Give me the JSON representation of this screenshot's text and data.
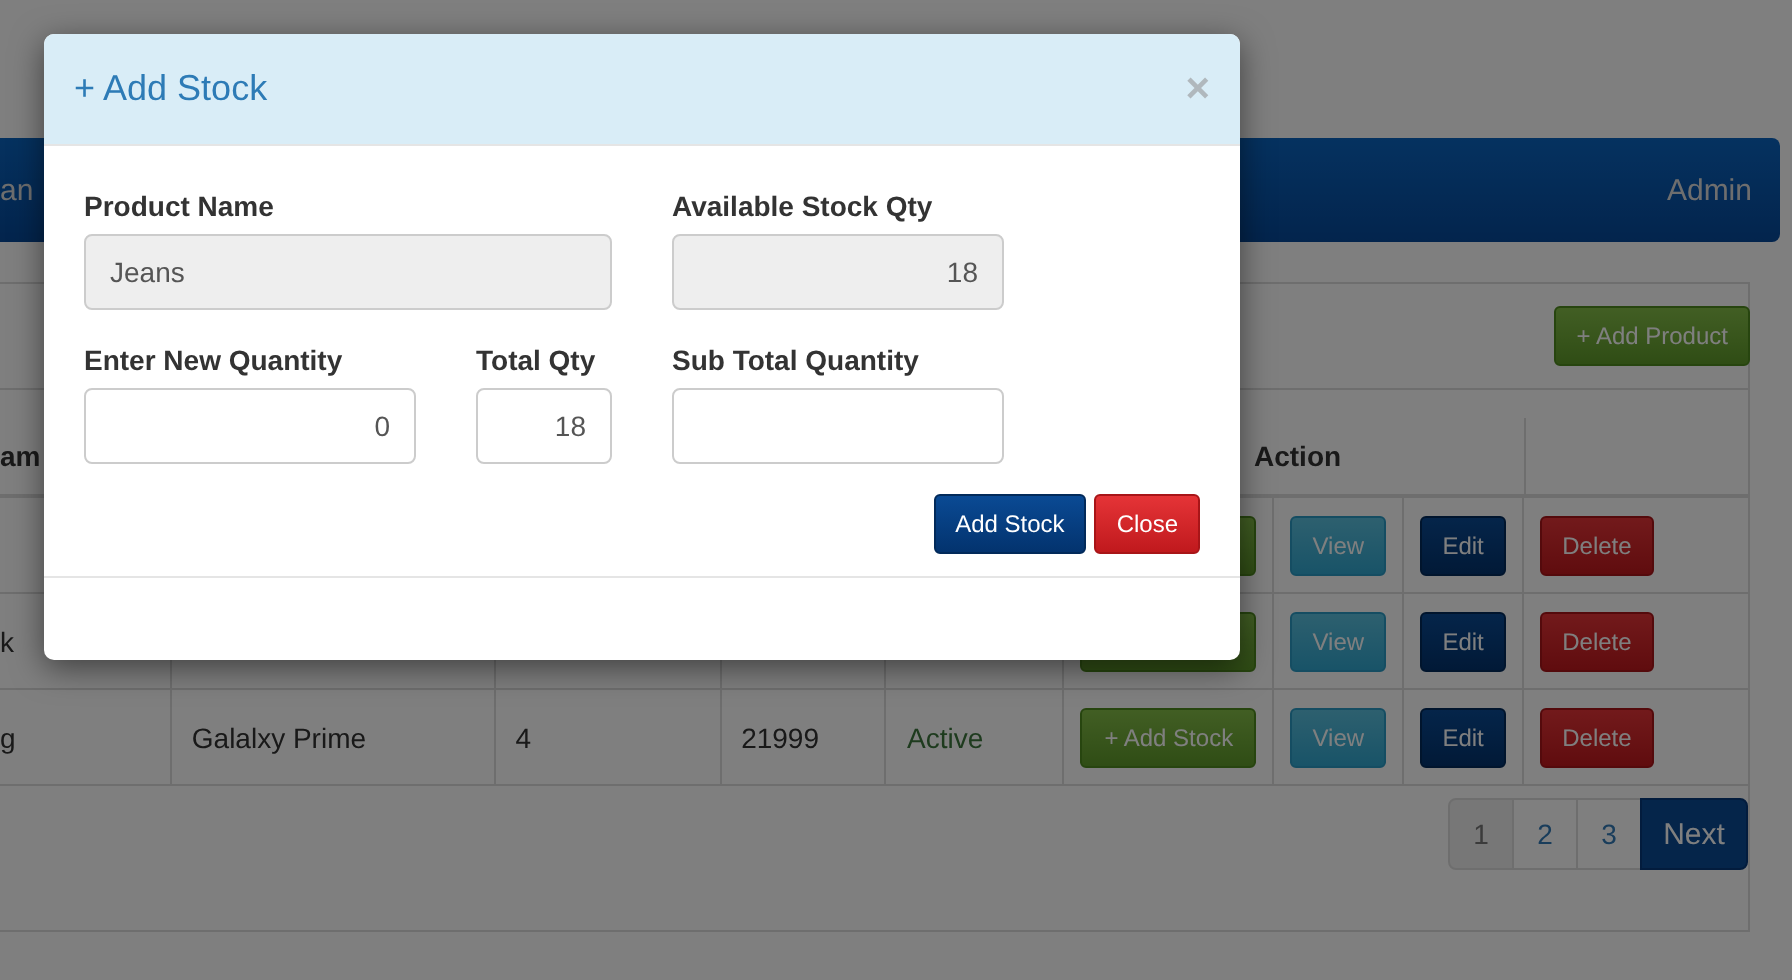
{
  "navbar": {
    "brand": "an",
    "user": "Admin"
  },
  "panel": {
    "add_button": "+ Add Product"
  },
  "table": {
    "columns": [
      "am",
      "Action"
    ],
    "rows": [
      {
        "actions": [
          {
            "kind": "add"
          },
          {
            "kind": "view",
            "label": "View"
          },
          {
            "kind": "edit",
            "label": "Edit"
          },
          {
            "kind": "delete",
            "label": "Delete"
          }
        ]
      },
      {
        "name": "k",
        "actions": [
          {
            "kind": "add"
          },
          {
            "kind": "view",
            "label": "View"
          },
          {
            "kind": "edit",
            "label": "Edit"
          },
          {
            "kind": "delete",
            "label": "Delete"
          }
        ]
      },
      {
        "name": "g",
        "product": "Galalxy Prime",
        "qty": "4",
        "price": "21999",
        "status": "Active",
        "actions": [
          {
            "kind": "add",
            "label": "+ Add Stock"
          },
          {
            "kind": "view",
            "label": "View"
          },
          {
            "kind": "edit",
            "label": "Edit"
          },
          {
            "kind": "delete",
            "label": "Delete"
          }
        ]
      }
    ]
  },
  "pagination": {
    "pages": [
      {
        "label": "1",
        "selected": true
      },
      {
        "label": "2",
        "selected": false
      },
      {
        "label": "3",
        "selected": false
      }
    ],
    "next": "Next"
  },
  "modal": {
    "title": "+ Add Stock",
    "close_icon": "×",
    "fields": [
      {
        "label": "Product Name",
        "value": "Jeans",
        "disabled": true
      },
      {
        "label": "Available Stock Qty",
        "value": "18",
        "disabled": true
      },
      {
        "label": "Enter New Quantity",
        "value": "0",
        "disabled": false
      },
      {
        "label": "Total Qty",
        "value": "18",
        "disabled": false
      },
      {
        "label": "Sub Total Quantity",
        "disabled": false
      }
    ],
    "buttons": [
      {
        "kind": "primary",
        "label": "Add Stock"
      },
      {
        "kind": "danger",
        "label": "Close"
      }
    ]
  }
}
